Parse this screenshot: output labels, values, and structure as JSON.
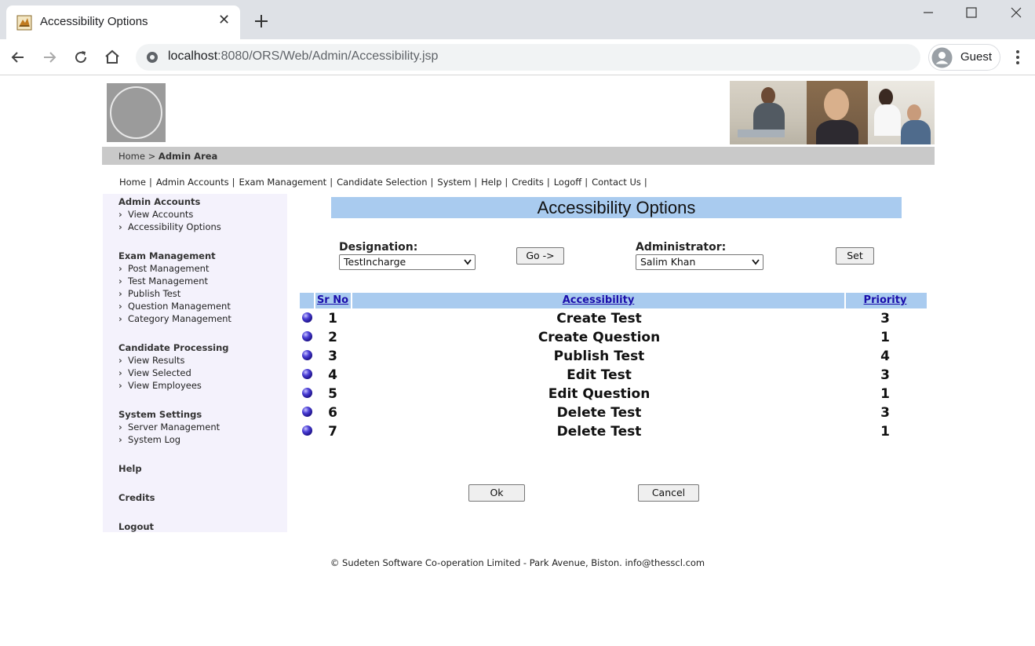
{
  "browser": {
    "tab_title": "Accessibility Options",
    "url_host": "localhost",
    "url_rest": ":8080/ORS/Web/Admin/Accessibility.jsp",
    "profile_label": "Guest"
  },
  "breadcrumb": {
    "home": "Home",
    "separator": ">",
    "current": "Admin Area"
  },
  "topnav": {
    "items": [
      "Home",
      "Admin Accounts",
      "Exam Management",
      "Candidate Selection",
      "System",
      "Help",
      "Credits",
      "Logoff",
      "Contact Us"
    ],
    "separator": "|"
  },
  "sidebar": {
    "groups": [
      {
        "title": "Admin Accounts",
        "items": [
          "View Accounts",
          "Accessibility Options"
        ]
      },
      {
        "title": "Exam Management",
        "items": [
          "Post Management",
          "Test Management",
          "Publish Test",
          "Question Management",
          "Category Management"
        ]
      },
      {
        "title": "Candidate Processing",
        "items": [
          "View Results",
          "View Selected",
          "View Employees"
        ]
      },
      {
        "title": "System Settings",
        "items": [
          "Server Management",
          "System Log"
        ]
      },
      {
        "title": "Help",
        "items": []
      },
      {
        "title": "Credits",
        "items": []
      },
      {
        "title": "Logout",
        "items": []
      }
    ]
  },
  "content": {
    "title": "Accessibility Options",
    "designation_label": "Designation:",
    "designation_value": "TestIncharge",
    "go_button": "Go ->",
    "administrator_label": "Administrator:",
    "administrator_value": "Salim Khan",
    "set_button": "Set",
    "table": {
      "headers": {
        "sr_no": "Sr No",
        "accessibility": "Accessibility",
        "priority": "Priority"
      },
      "rows": [
        {
          "sr_no": "1",
          "accessibility": "Create Test",
          "priority": "3"
        },
        {
          "sr_no": "2",
          "accessibility": "Create Question",
          "priority": "1"
        },
        {
          "sr_no": "3",
          "accessibility": "Publish Test",
          "priority": "4"
        },
        {
          "sr_no": "4",
          "accessibility": "Edit Test",
          "priority": "3"
        },
        {
          "sr_no": "5",
          "accessibility": "Edit Question",
          "priority": "1"
        },
        {
          "sr_no": "6",
          "accessibility": "Delete Test",
          "priority": "3"
        },
        {
          "sr_no": "7",
          "accessibility": "Delete Test",
          "priority": "1"
        }
      ]
    },
    "ok_button": "Ok",
    "cancel_button": "Cancel"
  },
  "footer": {
    "text": "© Sudeten Software Co-operation Limited - Park Avenue, Biston. info@thesscl.com"
  },
  "colors": {
    "header_blue": "#a9cbef",
    "sidebar_bg": "#f4f2fc",
    "breadcrumb_bg": "#c9c9c9",
    "link_blue": "#1a0dab"
  }
}
